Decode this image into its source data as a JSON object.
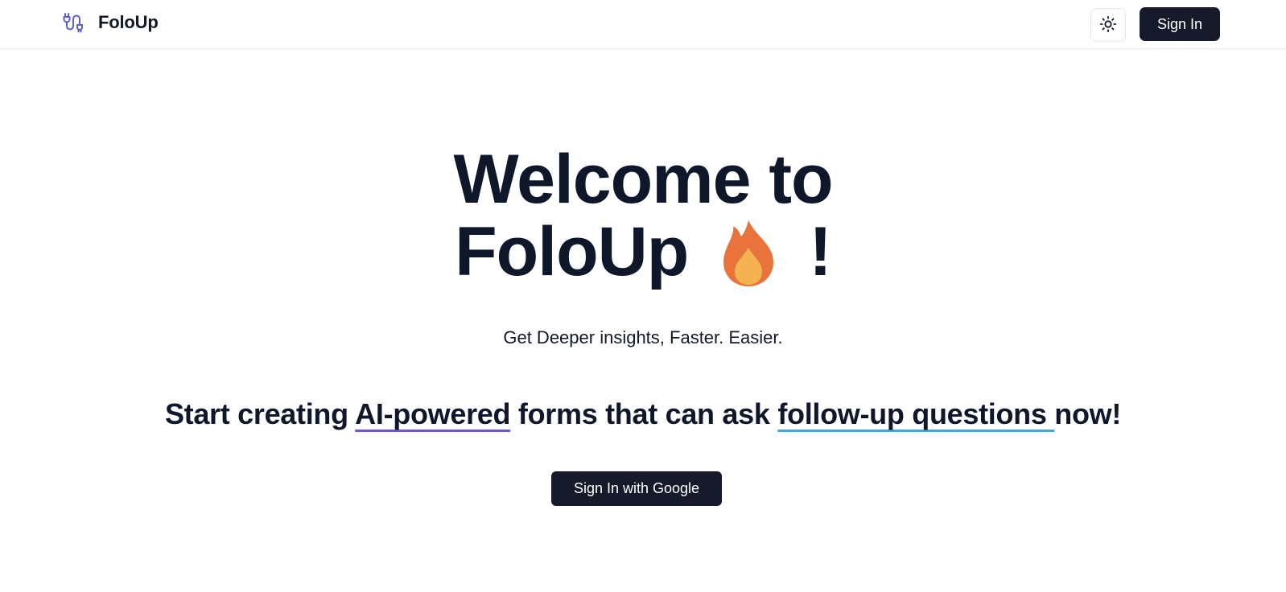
{
  "header": {
    "brand_name": "FoloUp",
    "brand_icon": "plug-cable-icon",
    "theme_toggle_icon": "sun-icon",
    "sign_in_label": "Sign In"
  },
  "hero": {
    "title_line1": "Welcome to",
    "title_line2_word": "FoloUp",
    "title_emoji_icon": "fire-icon",
    "title_end": "!",
    "subtitle": "Get Deeper insights, Faster. Easier.",
    "tagline": {
      "part1": "Start creating ",
      "highlight1": "AI-powered",
      "part2": " forms that can ask ",
      "highlight2": "follow-up questions ",
      "part3": "now!"
    },
    "google_button_label": "Sign In with Google"
  },
  "colors": {
    "primary_dark": "#161a2b",
    "brand_icon": "#5b5fc7",
    "underline_purple": "#6b5bd6",
    "underline_blue": "#3fa7dc",
    "fire_outer": "#e8743b",
    "fire_inner": "#f4b350"
  }
}
